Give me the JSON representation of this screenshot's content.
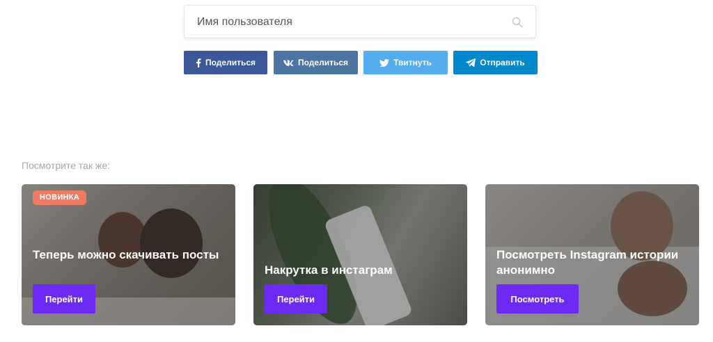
{
  "search": {
    "placeholder": "Имя пользователя"
  },
  "share": {
    "facebook_label": "Поделиться",
    "vk_label": "Поделиться",
    "twitter_label": "Твитнуть",
    "telegram_label": "Отправить"
  },
  "see_also": {
    "heading": "Посмотрите так же:"
  },
  "cards": [
    {
      "badge": "НОВИНКА",
      "title": "Теперь можно скачивать посты",
      "button": "Перейти"
    },
    {
      "title": "Накрутка в инстаграм",
      "button": "Перейти"
    },
    {
      "title": "Посмотреть Instagram истории анонимно",
      "button": "Посмотреть"
    }
  ],
  "colors": {
    "facebook": "#3b5998",
    "vk": "#4c75a3",
    "twitter": "#55acee",
    "telegram": "#0088cc",
    "accent_button": "#6c2bf5",
    "badge": "#f07c64"
  }
}
